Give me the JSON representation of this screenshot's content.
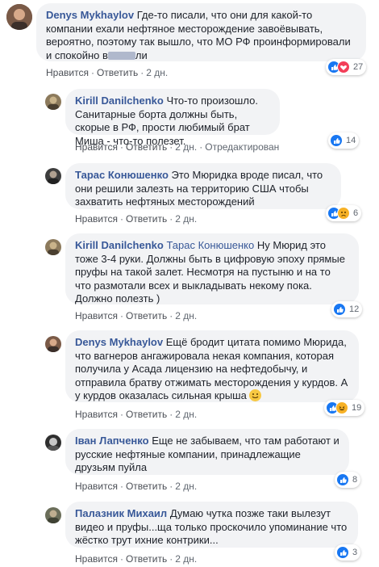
{
  "actions": {
    "like": "Нравится",
    "reply": "Ответить",
    "edited": "Отредактирован"
  },
  "comments": [
    {
      "author": "Denys Mykhaylov",
      "text_before": "Где-то писали, что они для какой-то компании ехали нефтяное месторождение завоёвывать, вероятно, поэтому так вышло, что МО РФ проинформировали и спокойно в",
      "text_after": "ли",
      "time": "2 дн.",
      "reactions": "27"
    },
    {
      "author": "Kirill Danilchenko",
      "text": "Что-то произошло. Санитарные борта должны быть, скорые в РФ, прости любимый брат Миша - что-то полезет.",
      "time": "2 дн.",
      "reactions": "14"
    },
    {
      "author": "Тарас Конюшенко",
      "text": "Это Мюридка вроде писал, что они решили залезть на территорию США чтобы захватить нефтяных месторождений",
      "time": "2 дн.",
      "reactions": "6"
    },
    {
      "author": "Kirill Danilchenko",
      "mention": "Тарас Конюшенко",
      "text": "Ну Мюрид это тоже 3-4 руки. Должны быть в цифровую эпоху прямые пруфы на такой залет. Несмотря на пустыню и на то что размотали всех и выкладывать некому пока. Должно полезть )",
      "time": "2 дн.",
      "reactions": "12"
    },
    {
      "author": "Denys Mykhaylov",
      "text": "Ещё бродит цитата помимо Мюрида, что вагнеров ангажировала некая компания, которая получила у Асада лицензию на нефтедобычу, и отправила братву отжимать месторождения у курдов. А у курдов оказалась сильная крыша",
      "time": "2 дн.",
      "reactions": "19"
    },
    {
      "author": "Іван Лапченко",
      "text": "Еще не забываем, что там работают и русские нефтяные компании, принадлежащие друзьям пуйла",
      "time": "2 дн.",
      "reactions": "8"
    },
    {
      "author": "Палазник Михаил",
      "text": "Думаю чутка позже таки вылезут видео и пруфы...ща только проскочило упоминание что жёстко трут ихние контрики...",
      "time": "2 дн.",
      "reactions": "3"
    }
  ]
}
